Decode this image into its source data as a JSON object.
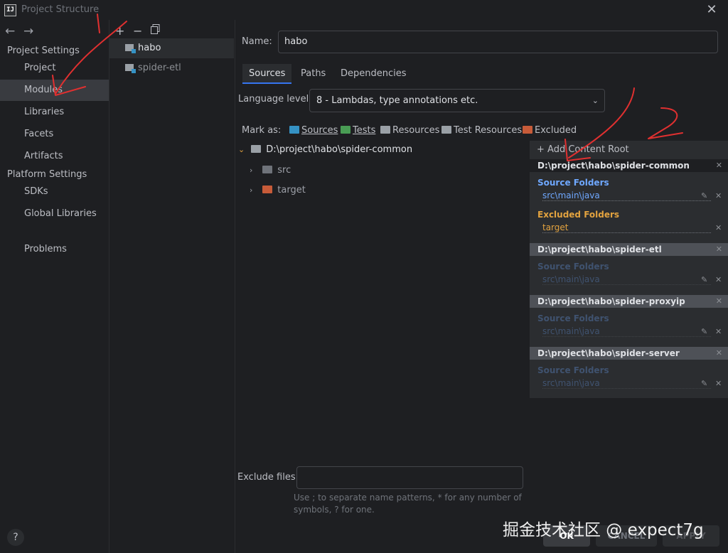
{
  "window": {
    "title": "Project Structure",
    "close_icon": "close-icon"
  },
  "nav": {
    "back_icon": "arrow-left-icon",
    "forward_icon": "arrow-right-icon",
    "section_project_settings": "Project Settings",
    "section_platform_settings": "Platform Settings",
    "items": [
      "Project",
      "Modules",
      "Libraries",
      "Facets",
      "Artifacts"
    ],
    "platform_items": [
      "SDKs",
      "Global Libraries"
    ],
    "problems": "Problems",
    "selected": "Modules",
    "help": "?"
  },
  "modules": {
    "add_icon": "plus-icon",
    "remove_icon": "minus-icon",
    "copy_icon": "copy-icon",
    "items": [
      "habo",
      "spider-etl"
    ],
    "selected": "habo"
  },
  "main": {
    "name_label": "Name:",
    "name_value": "habo",
    "tabs": [
      "Sources",
      "Paths",
      "Dependencies"
    ],
    "active_tab": "Sources",
    "language_label": "Language level:",
    "language_value": "8 - Lambdas, type annotations etc.",
    "mark_as_label": "Mark as:",
    "mark_as": [
      {
        "label": "Sources",
        "color": "#3592c4"
      },
      {
        "label": "Tests",
        "color": "#499c54"
      },
      {
        "label": "Resources",
        "color": "#9aa0a6"
      },
      {
        "label": "Test Resources",
        "color": "#9aa0a6"
      },
      {
        "label": "Excluded",
        "color": "#c75b39"
      }
    ],
    "tree": {
      "root": "D:\\project\\habo\\spider-common",
      "children": [
        "src",
        "target"
      ]
    },
    "exclude_label": "Exclude files:",
    "exclude_value": "",
    "exclude_hint_1": "Use ; to separate name patterns, * for any number of",
    "exclude_hint_2": "symbols, ? for one."
  },
  "roots": {
    "add_label": "Add Content Root",
    "entries": [
      {
        "path": "D:\\project\\habo\\spider-common",
        "source_title": "Source Folders",
        "source_path": "src\\main\\java",
        "excluded_title": "Excluded Folders",
        "excluded_path": "target"
      },
      {
        "path": "D:\\project\\habo\\spider-etl",
        "source_title": "Source Folders",
        "source_path": "src\\main\\java"
      },
      {
        "path": "D:\\project\\habo\\spider-proxyip",
        "source_title": "Source Folders",
        "source_path": "src\\main\\java"
      },
      {
        "path": "D:\\project\\habo\\spider-server",
        "source_title": "Source Folders",
        "source_path": "src\\main\\java"
      }
    ],
    "remove_mark": "✕"
  },
  "buttons": {
    "ok": "OK",
    "cancel": "CANCEL",
    "apply": "APPLY"
  },
  "watermark": "掘金技术社区 @ expect7g",
  "colors": {
    "accent": "#3574f0",
    "source": "#6fa8ff",
    "excluded": "#e3a33f",
    "annotation": "#e03030"
  }
}
